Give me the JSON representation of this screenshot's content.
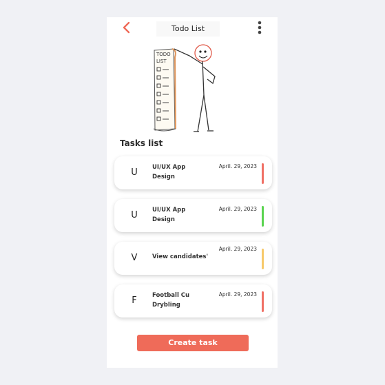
{
  "header": {
    "title": "Todo List",
    "back_icon": "chevron-left-icon",
    "menu_icon": "more-vertical-icon"
  },
  "hero": {
    "illustration": "stick-figure-holding-todo-list",
    "scroll_text": "TODO LIST"
  },
  "tasks_section": {
    "title": "Tasks list",
    "items": [
      {
        "avatar": "U",
        "title_line1": "UI/UX App",
        "title_line2": "Design",
        "date": "April. 29, 2023",
        "color": "#f07065"
      },
      {
        "avatar": "U",
        "title_line1": "UI/UX App",
        "title_line2": "Design",
        "date": "April. 29, 2023",
        "color": "#5ad44f"
      },
      {
        "avatar": "V",
        "title_line1": "View candidates'",
        "title_line2": "",
        "date": "April. 29, 2023",
        "color": "#f7c96a"
      },
      {
        "avatar": "F",
        "title_line1": "Football Cu",
        "title_line2": "Drybling",
        "date": "April. 29, 2023",
        "color": "#f07065"
      }
    ]
  },
  "footer": {
    "create_label": "Create task"
  },
  "colors": {
    "accent": "#ef6b59",
    "background": "#f0f1f5",
    "surface": "#ffffff"
  }
}
